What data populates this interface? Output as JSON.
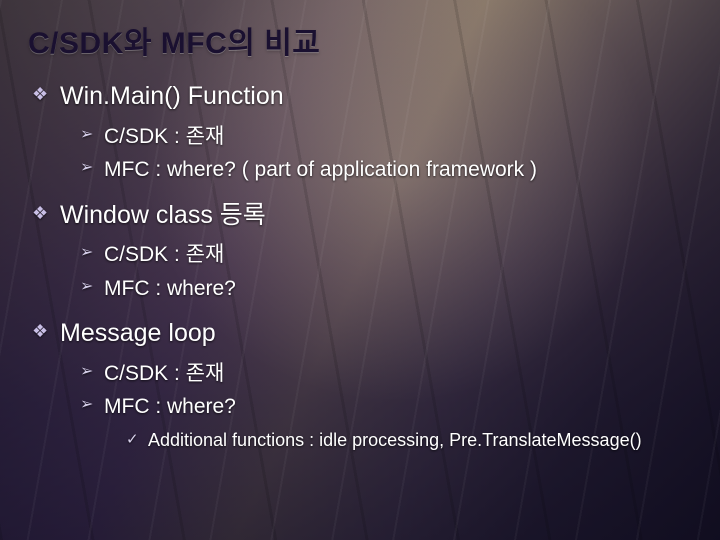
{
  "title": "C/SDK와 MFC의 비교",
  "sections": [
    {
      "heading": "Win.Main() Function",
      "items": [
        {
          "text": "C/SDK : 존재"
        },
        {
          "text": "MFC : where? ( part of application framework )"
        }
      ]
    },
    {
      "heading": "Window class 등록",
      "items": [
        {
          "text": "C/SDK : 존재"
        },
        {
          "text": "MFC : where?"
        }
      ]
    },
    {
      "heading": "Message loop",
      "items": [
        {
          "text": "C/SDK : 존재"
        },
        {
          "text": "MFC : where?",
          "subitems": [
            {
              "text": "Additional functions : idle processing, Pre.TranslateMessage()"
            }
          ]
        }
      ]
    }
  ]
}
